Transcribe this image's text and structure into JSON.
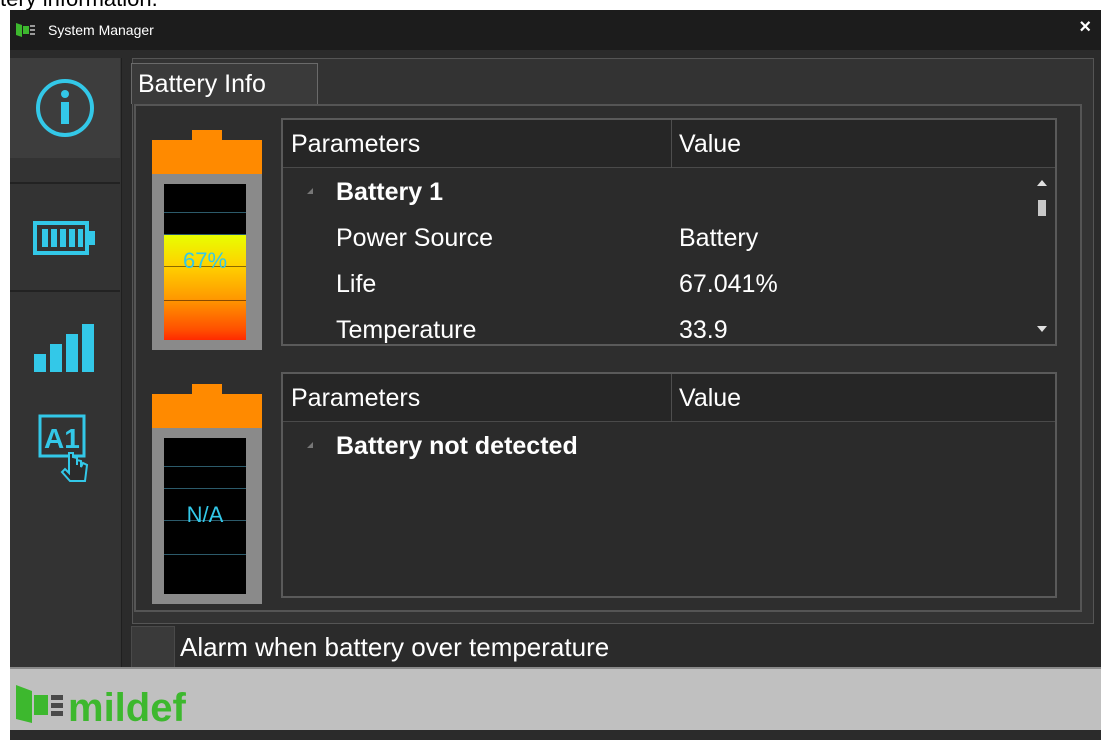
{
  "top_caption": "tery information.",
  "window": {
    "title": "System Manager",
    "close_label": "×"
  },
  "sidebar": {
    "items": [
      {
        "icon": "info-icon",
        "active": true
      },
      {
        "icon": "battery-icon",
        "active": false
      },
      {
        "icon": "signal-bars-icon",
        "active": false
      },
      {
        "icon": "a1-hand-icon",
        "active": false
      }
    ]
  },
  "tab": {
    "label": "Battery Info"
  },
  "battery1": {
    "level_percent": 67,
    "display": "67%",
    "table": {
      "col_param": "Parameters",
      "col_value": "Value",
      "group": "Battery 1",
      "rows": [
        {
          "param": "Power Source",
          "value": "Battery"
        },
        {
          "param": "Life",
          "value": "67.041%"
        },
        {
          "param": "Temperature",
          "value": "33.9"
        }
      ]
    }
  },
  "battery2": {
    "display": "N/A",
    "table": {
      "col_param": "Parameters",
      "col_value": "Value",
      "group": "Battery not detected"
    }
  },
  "alarm": {
    "label": "Alarm when battery over temperature",
    "checked": false
  },
  "footer": {
    "brand": "mildef"
  },
  "colors": {
    "accent_blue": "#33c8e8",
    "battery_cap": "#ff8a00",
    "brand_green": "#3db82e"
  }
}
